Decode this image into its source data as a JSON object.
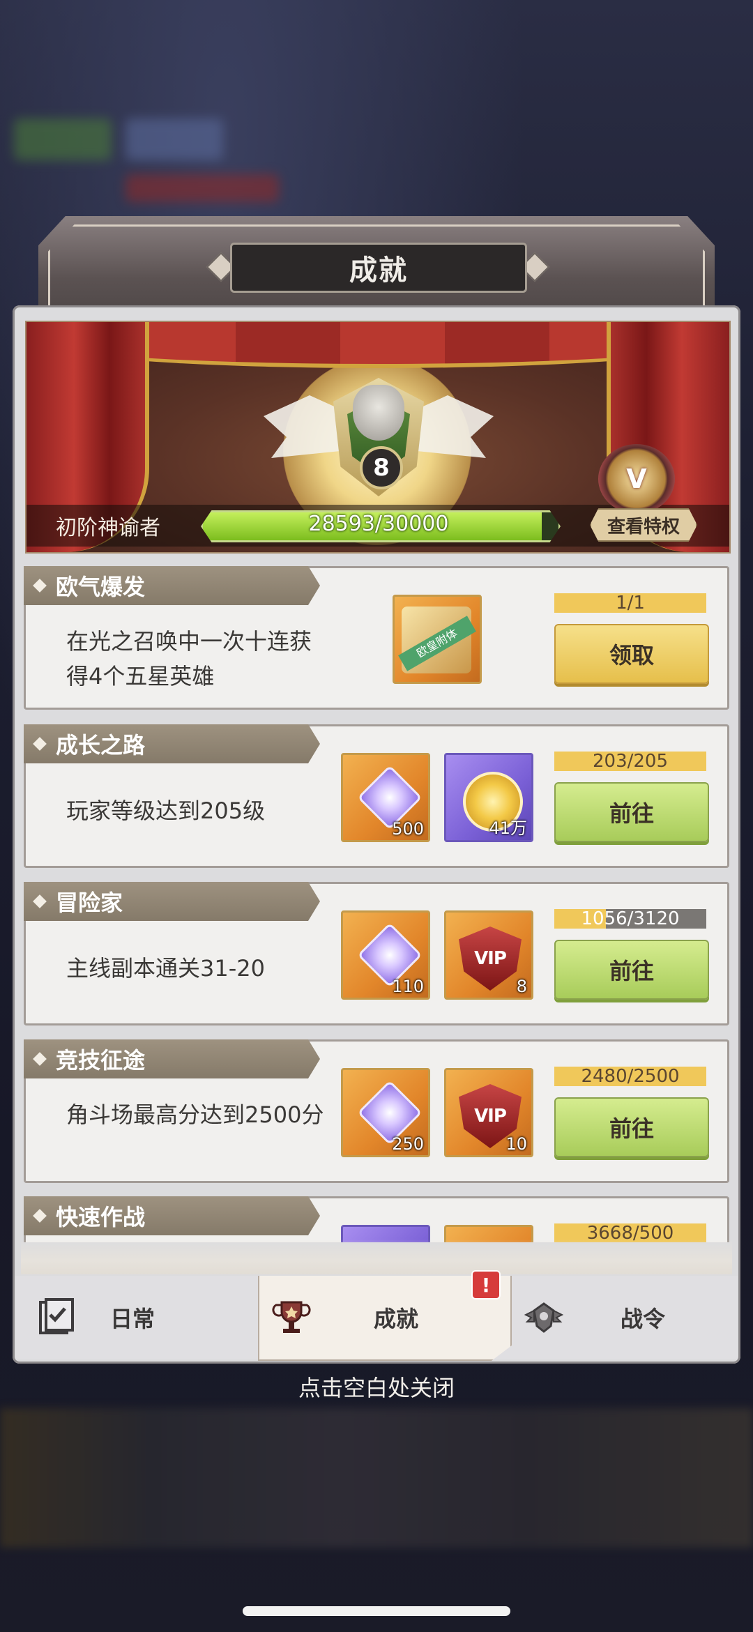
{
  "header": {
    "title": "成就"
  },
  "banner": {
    "level": "8",
    "rank_name": "初阶神谕者",
    "exp_text": "28593/30000",
    "exp_fraction": 0.953,
    "vip_icon_label": "V",
    "privilege_button": "查看特权"
  },
  "achievements": [
    {
      "title": "欧气爆发",
      "desc": "在光之召唤中一次十连获得4个五星英雄",
      "rewards": [
        {
          "kind": "frame",
          "sash": "欧皇附体",
          "qty": ""
        }
      ],
      "progress": "1/1",
      "progress_fraction": 1,
      "button": "领取",
      "button_style": "gold"
    },
    {
      "title": "成长之路",
      "desc": "玩家等级达到205级",
      "rewards": [
        {
          "kind": "gem",
          "qty": "500"
        },
        {
          "kind": "coin",
          "qty": "41万"
        }
      ],
      "progress": "203/205",
      "progress_fraction": 0.99,
      "button": "前往",
      "button_style": "green"
    },
    {
      "title": "冒险家",
      "desc": "主线副本通关31-20",
      "rewards": [
        {
          "kind": "gem",
          "qty": "110"
        },
        {
          "kind": "vip",
          "label": "VIP",
          "qty": "8"
        }
      ],
      "progress": "1056/3120",
      "progress_fraction": 0.34,
      "button": "前往",
      "button_style": "green"
    },
    {
      "title": "竞技征途",
      "desc": "角斗场最高分达到2500分",
      "rewards": [
        {
          "kind": "gem",
          "qty": "250"
        },
        {
          "kind": "vip",
          "label": "VIP",
          "qty": "10"
        }
      ],
      "progress": "2480/2500",
      "progress_fraction": 0.99,
      "button": "前往",
      "button_style": "green"
    },
    {
      "title": "快速作战",
      "desc": "",
      "rewards": [],
      "progress": "3668/500",
      "progress_fraction": 1,
      "button": "",
      "button_style": "green"
    }
  ],
  "tabs": [
    {
      "label": "日常",
      "icon": "checklist-icon",
      "active": false
    },
    {
      "label": "成就",
      "icon": "trophy-icon",
      "active": true
    },
    {
      "label": "战令",
      "icon": "wing-emblem-icon",
      "active": false
    }
  ],
  "tab_badge": "!",
  "close_hint": "点击空白处关闭"
}
